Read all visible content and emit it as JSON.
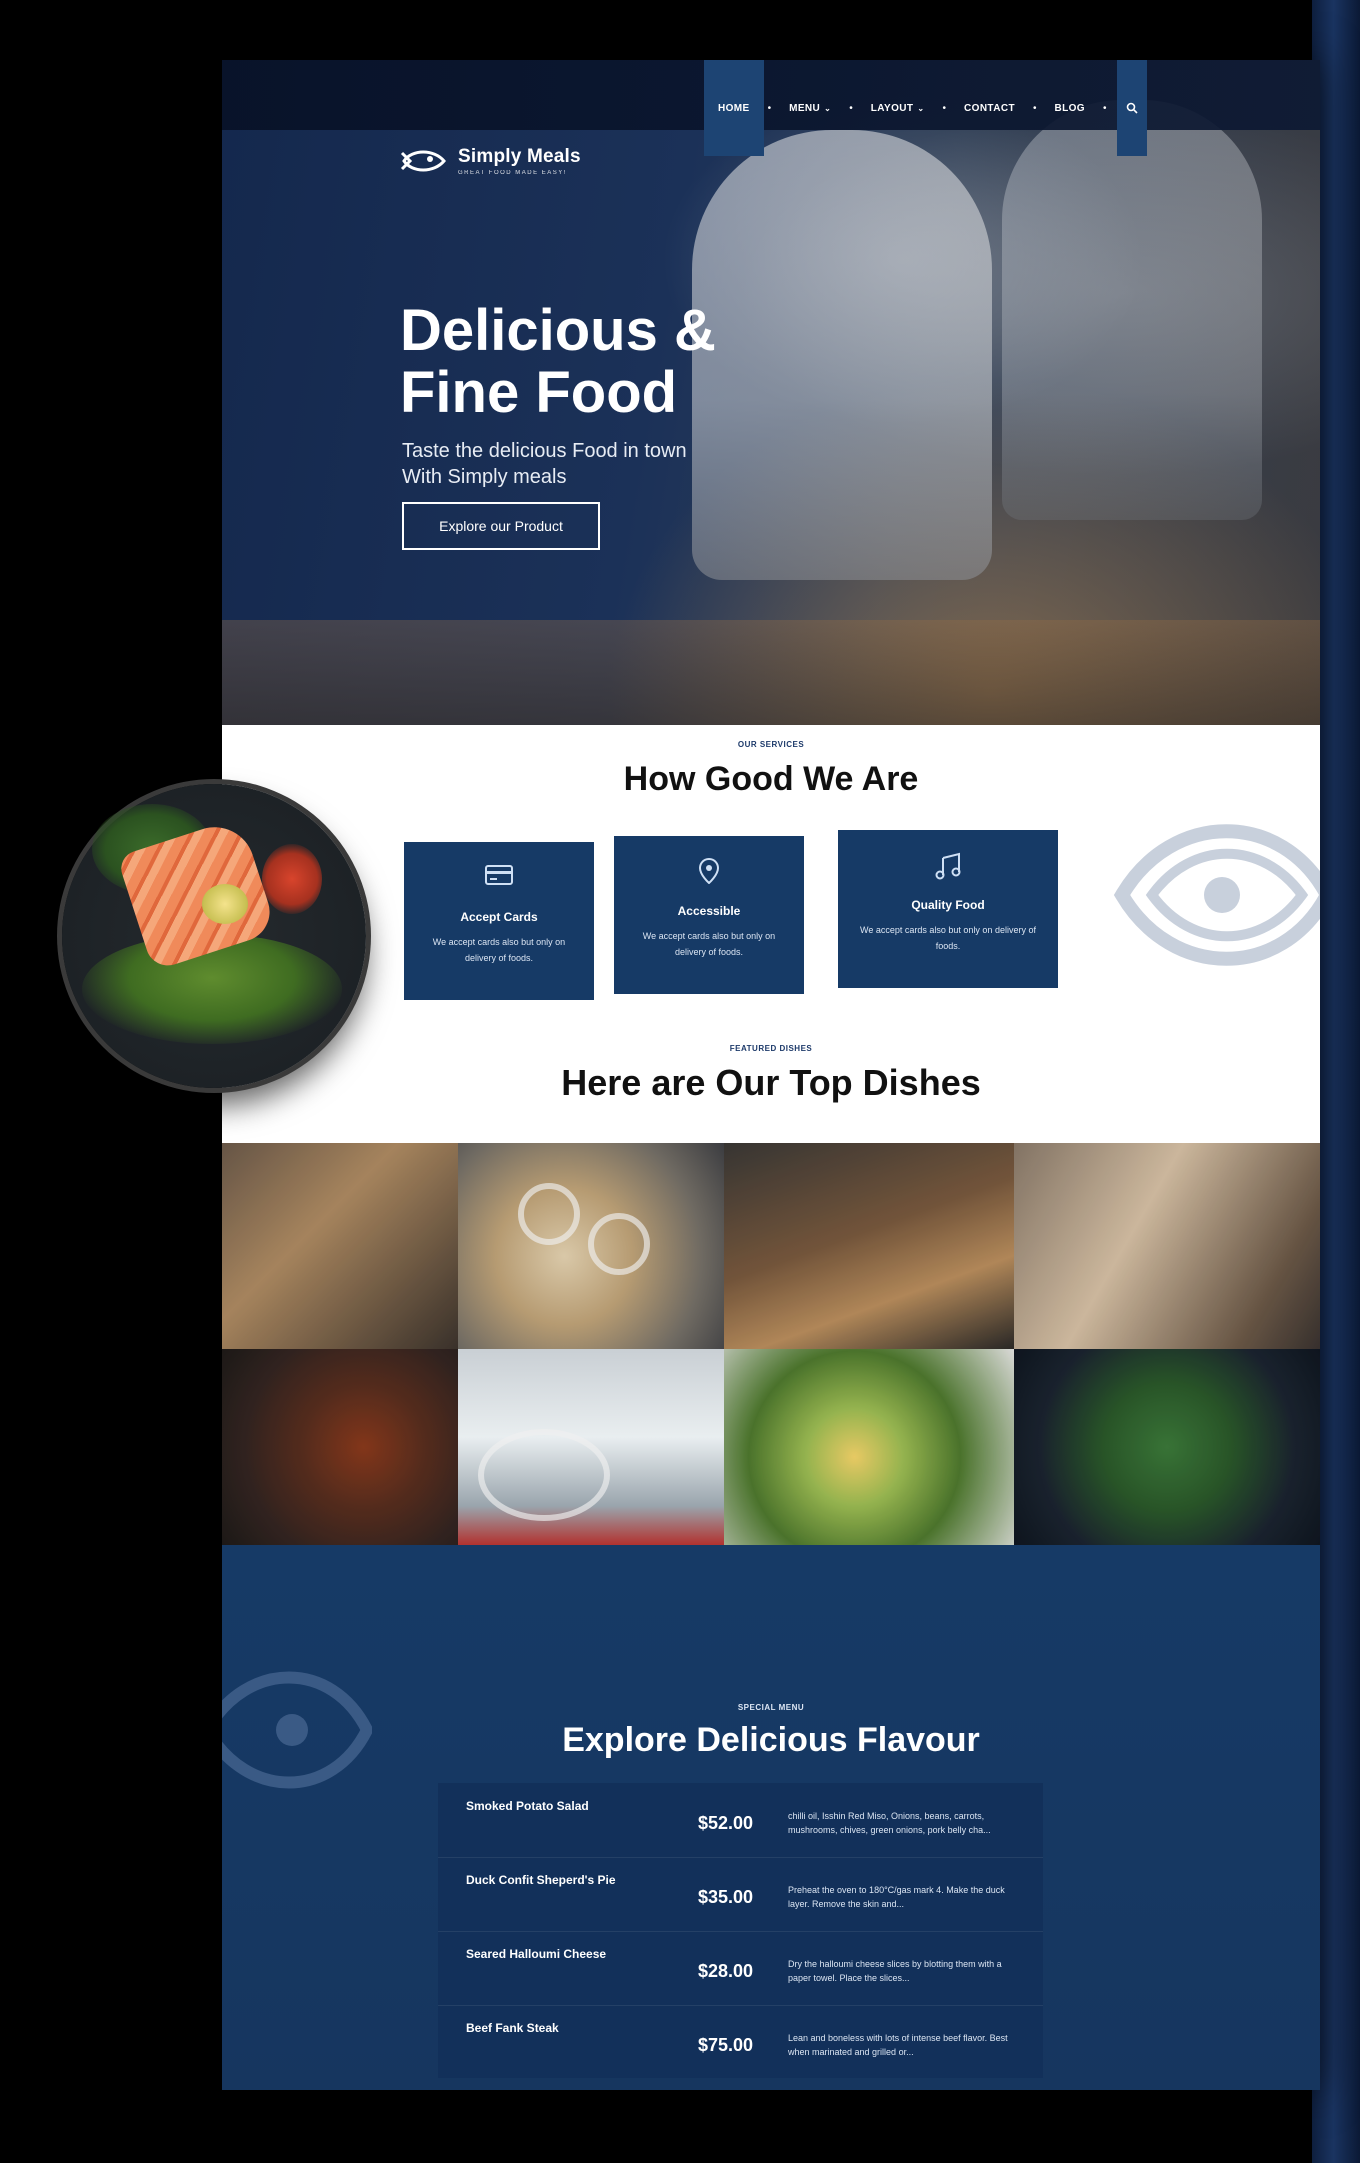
{
  "brand": {
    "name": "Simply Meals",
    "tagline": "GREAT FOOD MADE EASY!"
  },
  "nav": {
    "items": [
      {
        "label": "HOME",
        "active": true,
        "has_dropdown": false
      },
      {
        "label": "MENU",
        "active": false,
        "has_dropdown": true
      },
      {
        "label": "LAYOUT",
        "active": false,
        "has_dropdown": true
      },
      {
        "label": "CONTACT",
        "active": false,
        "has_dropdown": false
      },
      {
        "label": "BLOG",
        "active": false,
        "has_dropdown": false
      }
    ],
    "search_icon": "search-icon"
  },
  "hero": {
    "title_line1": "Delicious &",
    "title_line2": "Fine Food",
    "subtitle_line1": "Taste the delicious Food in town",
    "subtitle_line2": "With Simply meals",
    "cta": "Explore our Product"
  },
  "services": {
    "eyebrow": "OUR SERVICES",
    "title": "How Good We Are",
    "cards": [
      {
        "icon": "credit-card-icon",
        "title": "Accept Cards",
        "desc": "We accept cards also but only on delivery of foods."
      },
      {
        "icon": "map-pin-icon",
        "title": "Accessible",
        "desc": "We accept cards also but only on delivery of foods."
      },
      {
        "icon": "music-note-icon",
        "title": "Quality Food",
        "desc": "We accept cards also but only on delivery of foods."
      }
    ]
  },
  "featured": {
    "eyebrow": "FEATURED DISHES",
    "title": "Here are Our Top Dishes"
  },
  "special": {
    "eyebrow": "SPECIAL MENU",
    "title": "Explore Delicious Flavour",
    "items": [
      {
        "name": "Smoked Potato Salad",
        "price": "$52.00",
        "desc": "chilli oil, Isshin Red Miso, Onions, beans, carrots, mushrooms, chives, green onions, pork belly cha..."
      },
      {
        "name": "Duck Confit Sheperd's Pie",
        "price": "$35.00",
        "desc": "Preheat the oven to 180°C/gas mark 4. Make the duck layer. Remove the skin and..."
      },
      {
        "name": "Seared Halloumi Cheese",
        "price": "$28.00",
        "desc": "Dry the halloumi cheese slices by blotting them with a paper towel. Place the slices..."
      },
      {
        "name": "Beef Fank Steak",
        "price": "$75.00",
        "desc": "Lean and boneless with lots of intense beef flavor. Best when marinated and grilled or..."
      }
    ]
  },
  "colors": {
    "navy": "#163a66",
    "nav_active": "#1d4473",
    "dark_navy": "#12305a",
    "white": "#ffffff"
  }
}
